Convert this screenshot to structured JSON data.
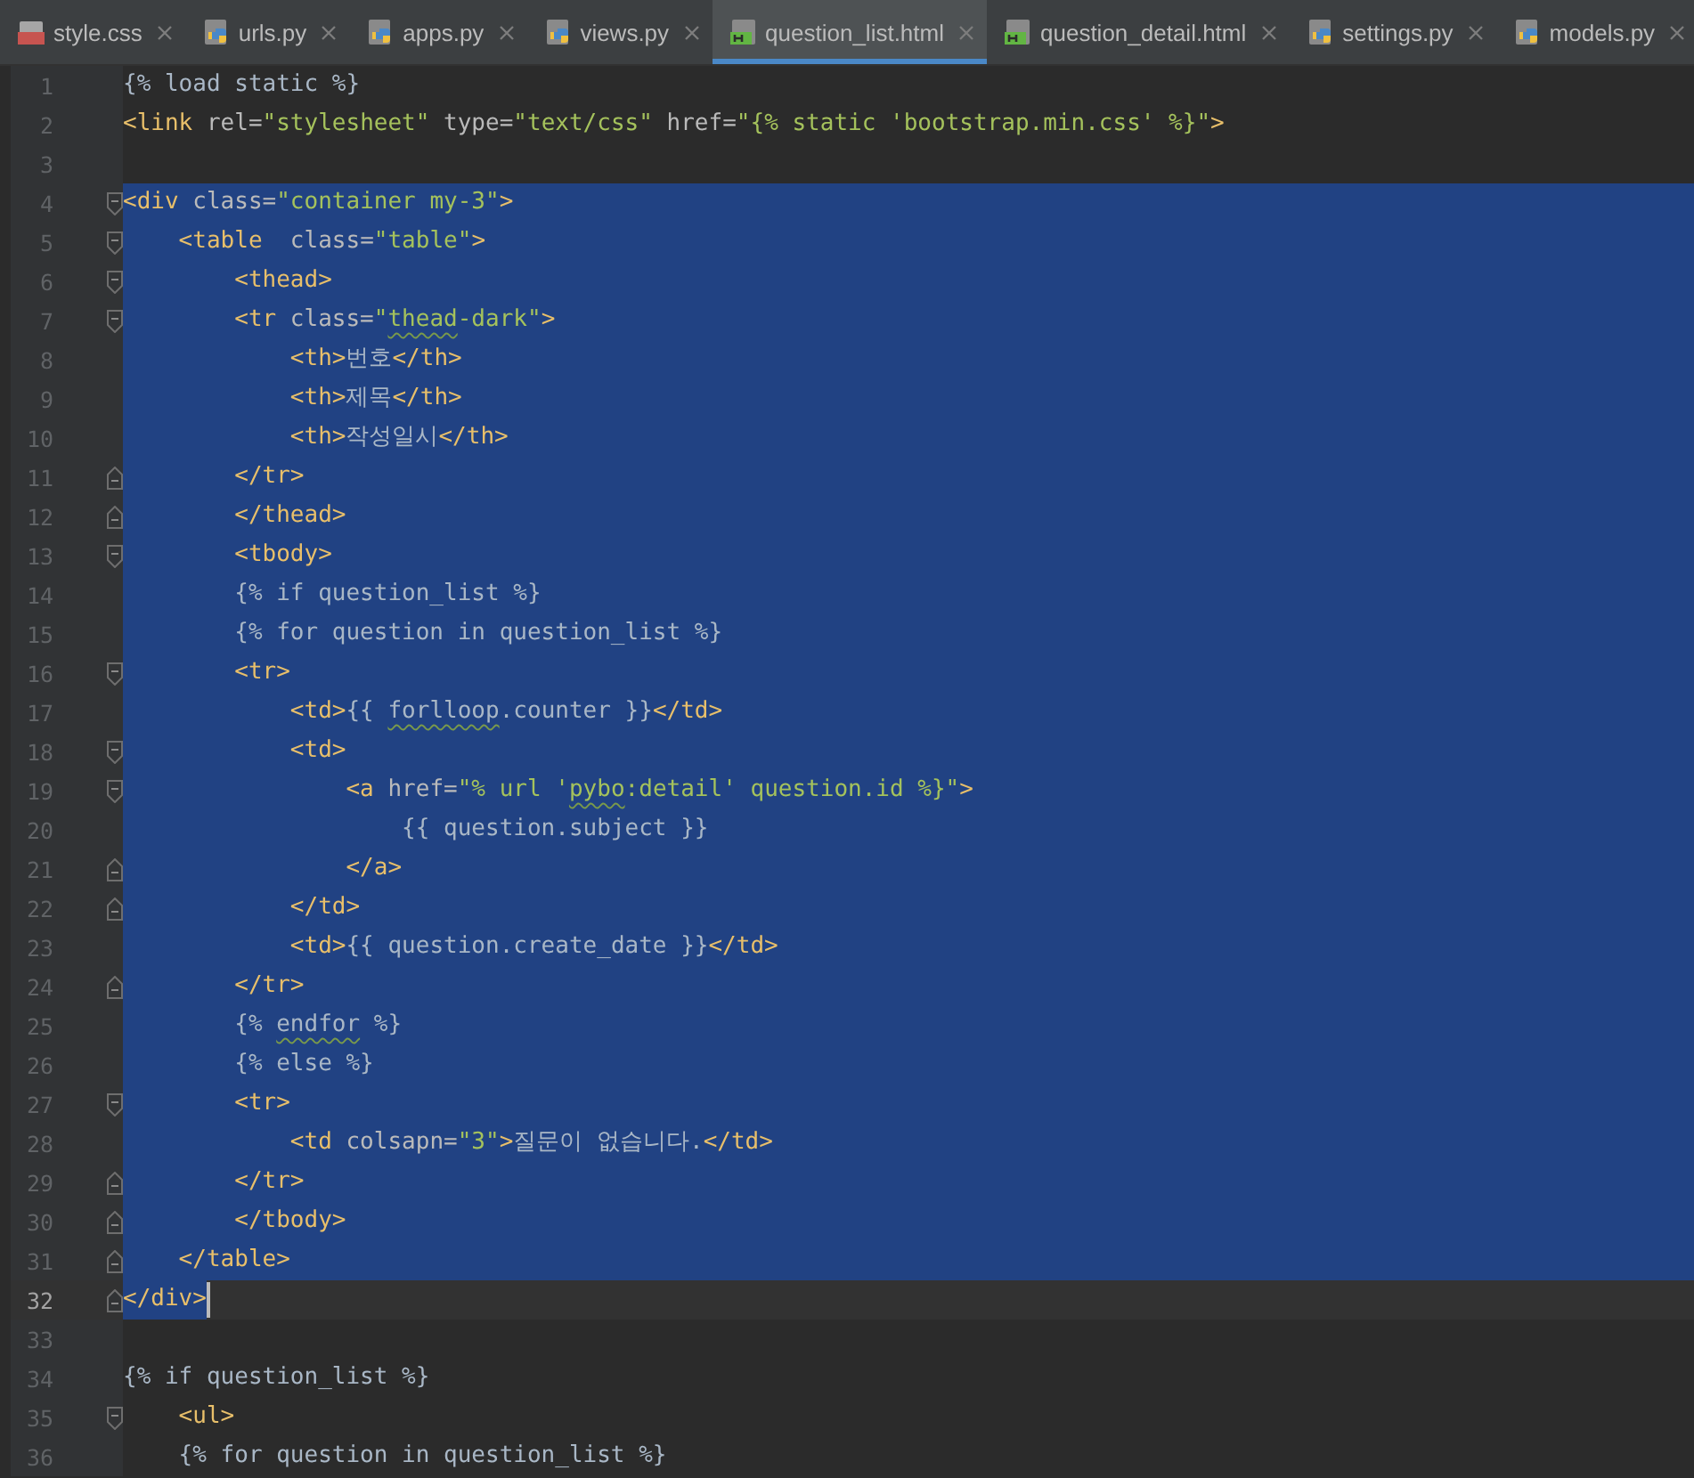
{
  "tabs": [
    {
      "label": "style.css",
      "kind": "css",
      "selected": false
    },
    {
      "label": "urls.py",
      "kind": "python",
      "selected": false
    },
    {
      "label": "apps.py",
      "kind": "python",
      "selected": false
    },
    {
      "label": "views.py",
      "kind": "python",
      "selected": false
    },
    {
      "label": "question_list.html",
      "kind": "html",
      "selected": true
    },
    {
      "label": "question_detail.html",
      "kind": "html",
      "selected": false
    },
    {
      "label": "settings.py",
      "kind": "python",
      "selected": false
    },
    {
      "label": "models.py",
      "kind": "python",
      "selected": false
    }
  ],
  "lines": [
    {
      "number": "1",
      "fold_start": false,
      "fold_end": false,
      "selected": false,
      "current": false,
      "tokens": [
        {
          "kind": "text",
          "text": "{% load static %}"
        }
      ]
    },
    {
      "number": "2",
      "fold_start": false,
      "fold_end": false,
      "selected": false,
      "current": false,
      "tokens": [
        {
          "kind": "tag",
          "text": "<link"
        },
        {
          "kind": "attr",
          "text": " rel="
        },
        {
          "kind": "value",
          "text": "\"stylesheet\""
        },
        {
          "kind": "attr",
          "text": " type="
        },
        {
          "kind": "value",
          "text": "\"text/css\""
        },
        {
          "kind": "attr",
          "text": " href="
        },
        {
          "kind": "value",
          "text": "\"{% static 'bootstrap.min.css' %}\""
        },
        {
          "kind": "tag",
          "text": ">"
        }
      ]
    },
    {
      "number": "3",
      "fold_start": false,
      "fold_end": false,
      "selected": false,
      "current": false
    },
    {
      "number": "4",
      "fold_start": true,
      "fold_end": false,
      "selected": true,
      "current": false,
      "tokens": [
        {
          "kind": "tag",
          "text": "<div"
        },
        {
          "kind": "attr",
          "text": " class="
        },
        {
          "kind": "value",
          "text": "\"container my-3\""
        },
        {
          "kind": "tag",
          "text": ">"
        }
      ]
    },
    {
      "number": "5",
      "fold_start": true,
      "fold_end": false,
      "selected": true,
      "current": false,
      "tokens": [
        {
          "kind": "tag",
          "text": "    <table"
        },
        {
          "kind": "attr",
          "text": "  class="
        },
        {
          "kind": "value",
          "text": "\"table\""
        },
        {
          "kind": "tag",
          "text": ">"
        }
      ]
    },
    {
      "number": "6",
      "fold_start": true,
      "fold_end": false,
      "selected": true,
      "current": false,
      "tokens": [
        {
          "kind": "tag",
          "text": "        <thead>"
        }
      ]
    },
    {
      "number": "7",
      "fold_start": true,
      "fold_end": false,
      "selected": true,
      "current": false,
      "tokens": [
        {
          "kind": "tag",
          "text": "        <tr"
        },
        {
          "kind": "attr",
          "text": " class="
        },
        {
          "kind": "value",
          "text": "\""
        },
        {
          "kind": "value",
          "text": "thead",
          "flagged": true
        },
        {
          "kind": "value",
          "text": "-dark\""
        },
        {
          "kind": "tag",
          "text": ">"
        }
      ]
    },
    {
      "number": "8",
      "fold_start": false,
      "fold_end": false,
      "selected": true,
      "current": false,
      "tokens": [
        {
          "kind": "tag",
          "text": "            <th>"
        },
        {
          "kind": "text",
          "text": "번호"
        },
        {
          "kind": "tag",
          "text": "</th>"
        }
      ]
    },
    {
      "number": "9",
      "fold_start": false,
      "fold_end": false,
      "selected": true,
      "current": false,
      "tokens": [
        {
          "kind": "tag",
          "text": "            <th>"
        },
        {
          "kind": "text",
          "text": "제목"
        },
        {
          "kind": "tag",
          "text": "</th>"
        }
      ]
    },
    {
      "number": "10",
      "fold_start": false,
      "fold_end": false,
      "selected": true,
      "current": false,
      "tokens": [
        {
          "kind": "tag",
          "text": "            <th>"
        },
        {
          "kind": "text",
          "text": "작성일시"
        },
        {
          "kind": "tag",
          "text": "</th>"
        }
      ]
    },
    {
      "number": "11",
      "fold_start": false,
      "fold_end": true,
      "selected": true,
      "current": false,
      "tokens": [
        {
          "kind": "tag",
          "text": "        </tr>"
        }
      ]
    },
    {
      "number": "12",
      "fold_start": false,
      "fold_end": true,
      "selected": true,
      "current": false,
      "tokens": [
        {
          "kind": "tag",
          "text": "        </thead>"
        }
      ]
    },
    {
      "number": "13",
      "fold_start": true,
      "fold_end": false,
      "selected": true,
      "current": false,
      "tokens": [
        {
          "kind": "tag",
          "text": "        <tbody>"
        }
      ]
    },
    {
      "number": "14",
      "fold_start": false,
      "fold_end": false,
      "selected": true,
      "current": false,
      "tokens": [
        {
          "kind": "text",
          "text": "        {% if question_list %}"
        }
      ]
    },
    {
      "number": "15",
      "fold_start": false,
      "fold_end": false,
      "selected": true,
      "current": false,
      "tokens": [
        {
          "kind": "text",
          "text": "        {% for question in question_list %}"
        }
      ]
    },
    {
      "number": "16",
      "fold_start": true,
      "fold_end": false,
      "selected": true,
      "current": false,
      "tokens": [
        {
          "kind": "tag",
          "text": "        <tr>"
        }
      ]
    },
    {
      "number": "17",
      "fold_start": false,
      "fold_end": false,
      "selected": true,
      "current": false,
      "tokens": [
        {
          "kind": "tag",
          "text": "            <td>"
        },
        {
          "kind": "text",
          "text": "{{ "
        },
        {
          "kind": "text",
          "text": "forlloop",
          "flagged": true
        },
        {
          "kind": "text",
          "text": ".counter }}"
        },
        {
          "kind": "tag",
          "text": "</td>"
        }
      ]
    },
    {
      "number": "18",
      "fold_start": true,
      "fold_end": false,
      "selected": true,
      "current": false,
      "tokens": [
        {
          "kind": "tag",
          "text": "            <td>"
        }
      ]
    },
    {
      "number": "19",
      "fold_start": true,
      "fold_end": false,
      "selected": true,
      "current": false,
      "tokens": [
        {
          "kind": "tag",
          "text": "                <a"
        },
        {
          "kind": "attr",
          "text": " href="
        },
        {
          "kind": "value",
          "text": "\"% url '"
        },
        {
          "kind": "value",
          "text": "pybo",
          "flagged": true
        },
        {
          "kind": "value",
          "text": ":detail' question.id %}\""
        },
        {
          "kind": "tag",
          "text": ">"
        }
      ]
    },
    {
      "number": "20",
      "fold_start": false,
      "fold_end": false,
      "selected": true,
      "current": false,
      "tokens": [
        {
          "kind": "text",
          "text": "                    {{ question.subject }}"
        }
      ]
    },
    {
      "number": "21",
      "fold_start": false,
      "fold_end": true,
      "selected": true,
      "current": false,
      "tokens": [
        {
          "kind": "tag",
          "text": "                </a>"
        }
      ]
    },
    {
      "number": "22",
      "fold_start": false,
      "fold_end": true,
      "selected": true,
      "current": false,
      "tokens": [
        {
          "kind": "tag",
          "text": "            </td>"
        }
      ]
    },
    {
      "number": "23",
      "fold_start": false,
      "fold_end": false,
      "selected": true,
      "current": false,
      "tokens": [
        {
          "kind": "tag",
          "text": "            <td>"
        },
        {
          "kind": "text",
          "text": "{{ question.create_date }}"
        },
        {
          "kind": "tag",
          "text": "</td>"
        }
      ]
    },
    {
      "number": "24",
      "fold_start": false,
      "fold_end": true,
      "selected": true,
      "current": false,
      "tokens": [
        {
          "kind": "tag",
          "text": "        </tr>"
        }
      ]
    },
    {
      "number": "25",
      "fold_start": false,
      "fold_end": false,
      "selected": true,
      "current": false,
      "tokens": [
        {
          "kind": "text",
          "text": "        {% "
        },
        {
          "kind": "text",
          "text": "endfor",
          "flagged": true
        },
        {
          "kind": "text",
          "text": " %}"
        }
      ]
    },
    {
      "number": "26",
      "fold_start": false,
      "fold_end": false,
      "selected": true,
      "current": false,
      "tokens": [
        {
          "kind": "text",
          "text": "        {% else %}"
        }
      ]
    },
    {
      "number": "27",
      "fold_start": true,
      "fold_end": false,
      "selected": true,
      "current": false,
      "tokens": [
        {
          "kind": "tag",
          "text": "        <tr>"
        }
      ]
    },
    {
      "number": "28",
      "fold_start": false,
      "fold_end": false,
      "selected": true,
      "current": false,
      "tokens": [
        {
          "kind": "tag",
          "text": "            <td"
        },
        {
          "kind": "attr",
          "text": " colsapn="
        },
        {
          "kind": "value",
          "text": "\"3\""
        },
        {
          "kind": "tag",
          "text": ">"
        },
        {
          "kind": "text",
          "text": "질문이 없습니다."
        },
        {
          "kind": "tag",
          "text": "</td>"
        }
      ]
    },
    {
      "number": "29",
      "fold_start": false,
      "fold_end": true,
      "selected": true,
      "current": false,
      "tokens": [
        {
          "kind": "tag",
          "text": "        </tr>"
        }
      ]
    },
    {
      "number": "30",
      "fold_start": false,
      "fold_end": true,
      "selected": true,
      "current": false,
      "tokens": [
        {
          "kind": "tag",
          "text": "        </tbody>"
        }
      ]
    },
    {
      "number": "31",
      "fold_start": false,
      "fold_end": true,
      "selected": true,
      "current": false,
      "tokens": [
        {
          "kind": "tag",
          "text": "    </table>"
        }
      ]
    },
    {
      "number": "32",
      "fold_start": false,
      "fold_end": true,
      "selected": true,
      "current": true,
      "tokens": [
        {
          "kind": "tag",
          "text": "</div>"
        }
      ]
    },
    {
      "number": "33",
      "fold_start": false,
      "fold_end": false,
      "selected": false,
      "current": false
    },
    {
      "number": "34",
      "fold_start": false,
      "fold_end": false,
      "selected": false,
      "current": false,
      "tokens": [
        {
          "kind": "text",
          "text": "{% if question_list %}"
        }
      ]
    },
    {
      "number": "35",
      "fold_start": true,
      "fold_end": false,
      "selected": false,
      "current": false,
      "tokens": [
        {
          "kind": "tag",
          "text": "    <ul>"
        }
      ]
    },
    {
      "number": "36",
      "fold_start": false,
      "fold_end": false,
      "selected": false,
      "current": false,
      "tokens": [
        {
          "kind": "text",
          "text": "    {% for question in question_list %}"
        }
      ]
    }
  ]
}
